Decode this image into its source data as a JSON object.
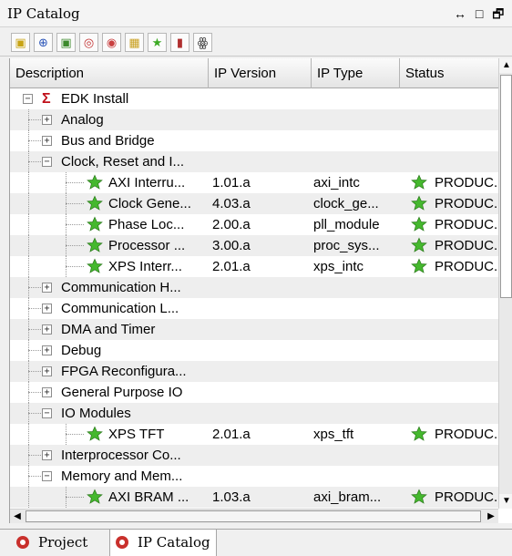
{
  "window": {
    "title": "IP Catalog",
    "controls": "↔ □ 🗗 ×"
  },
  "toolbar": {
    "buttons": [
      {
        "name": "new-folder-icon",
        "glyph": "▣",
        "color": "#c8a414"
      },
      {
        "name": "expand-all-icon",
        "glyph": "⊕",
        "color": "#2a54b8"
      },
      {
        "name": "add-ip-icon",
        "glyph": "▣",
        "color": "#3c8a2c"
      },
      {
        "name": "refresh-icon",
        "glyph": "◎",
        "color": "#c23030"
      },
      {
        "name": "production-filter-icon",
        "glyph": "◉",
        "color": "#c94040"
      },
      {
        "name": "lock-icon",
        "glyph": "▦",
        "color": "#c9a020"
      },
      {
        "name": "star-filter-icon",
        "glyph": "★",
        "color": "#3caa24"
      },
      {
        "name": "book-icon",
        "glyph": "▮",
        "color": "#b03030"
      },
      {
        "name": "binoculars-icon",
        "glyph": "ꙮ",
        "color": "#333333"
      }
    ]
  },
  "table": {
    "columns": [
      "Description",
      "IP Version",
      "IP Type",
      "Status"
    ],
    "rows": [
      {
        "kind": "root",
        "label": "EDK Install",
        "version": "",
        "type": "",
        "status": ""
      },
      {
        "kind": "category",
        "expanded": false,
        "label": "Analog",
        "version": "",
        "type": "",
        "status": ""
      },
      {
        "kind": "category",
        "expanded": false,
        "label": "Bus and Bridge",
        "version": "",
        "type": "",
        "status": ""
      },
      {
        "kind": "category",
        "expanded": true,
        "label": "Clock, Reset and I...",
        "version": "",
        "type": "",
        "status": ""
      },
      {
        "kind": "ip",
        "label": "AXI Interru...",
        "version": "1.01.a",
        "type": "axi_intc",
        "status": "PRODUC."
      },
      {
        "kind": "ip",
        "label": "Clock Gene...",
        "version": "4.03.a",
        "type": "clock_ge...",
        "status": "PRODUC."
      },
      {
        "kind": "ip",
        "label": "Phase Loc...",
        "version": "2.00.a",
        "type": "pll_module",
        "status": "PRODUC."
      },
      {
        "kind": "ip",
        "label": "Processor ...",
        "version": "3.00.a",
        "type": "proc_sys...",
        "status": "PRODUC."
      },
      {
        "kind": "ip",
        "label": "XPS Interr...",
        "version": "2.01.a",
        "type": "xps_intc",
        "status": "PRODUC."
      },
      {
        "kind": "category",
        "expanded": false,
        "label": "Communication H...",
        "version": "",
        "type": "",
        "status": ""
      },
      {
        "kind": "category",
        "expanded": false,
        "label": "Communication L...",
        "version": "",
        "type": "",
        "status": ""
      },
      {
        "kind": "category",
        "expanded": false,
        "label": "DMA and Timer",
        "version": "",
        "type": "",
        "status": ""
      },
      {
        "kind": "category",
        "expanded": false,
        "label": "Debug",
        "version": "",
        "type": "",
        "status": ""
      },
      {
        "kind": "category",
        "expanded": false,
        "label": "FPGA Reconfigura...",
        "version": "",
        "type": "",
        "status": ""
      },
      {
        "kind": "category",
        "expanded": false,
        "label": "General Purpose IO",
        "version": "",
        "type": "",
        "status": ""
      },
      {
        "kind": "category",
        "expanded": true,
        "label": "IO Modules",
        "version": "",
        "type": "",
        "status": ""
      },
      {
        "kind": "ip",
        "label": "XPS TFT",
        "version": "2.01.a",
        "type": "xps_tft",
        "status": "PRODUC."
      },
      {
        "kind": "category",
        "expanded": false,
        "label": "Interprocessor Co...",
        "version": "",
        "type": "",
        "status": ""
      },
      {
        "kind": "category",
        "expanded": true,
        "label": "Memory and Mem...",
        "version": "",
        "type": "",
        "status": ""
      },
      {
        "kind": "ip",
        "label": "AXI BRAM ...",
        "version": "1.03.a",
        "type": "axi_bram...",
        "status": "PRODUC."
      }
    ]
  },
  "tabs": [
    {
      "label": "Project",
      "active": false
    },
    {
      "label": "IP Catalog",
      "active": true
    }
  ],
  "colors": {
    "root_sigma": "#c0101a",
    "star_green": "#45b82e",
    "alt_row": "#eeeeee"
  },
  "icons": {
    "root": "sigma-icon",
    "ip": "star-icon",
    "expand": "plus-box-icon",
    "collapse": "minus-box-icon"
  }
}
